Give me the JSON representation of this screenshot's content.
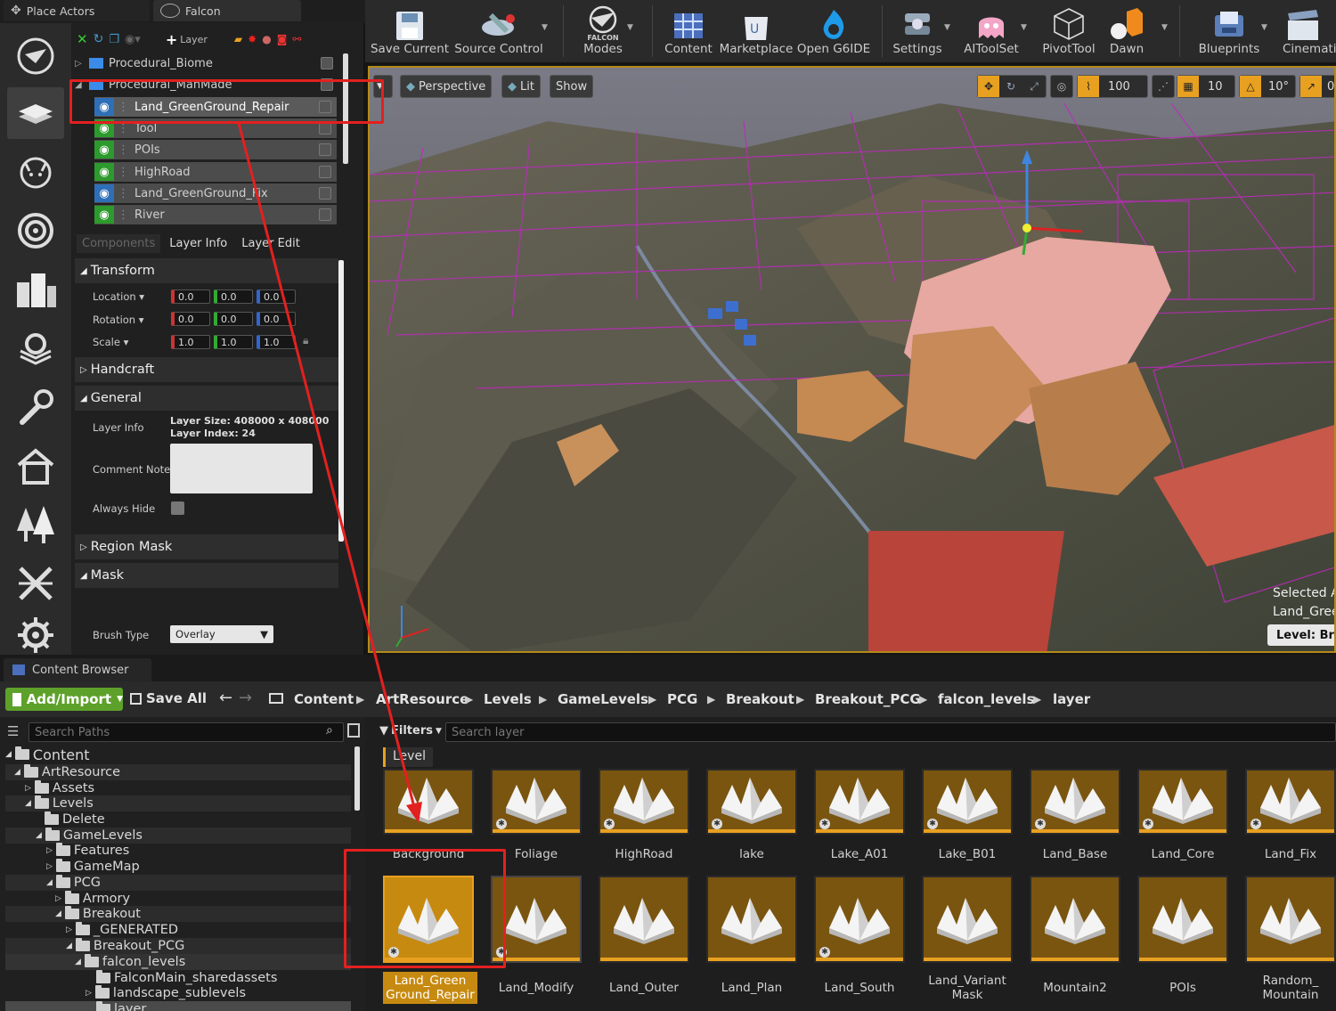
{
  "tabs": {
    "place_actors": "Place Actors",
    "falcon": "Falcon"
  },
  "layers": {
    "toolbar_add_label": "Layer",
    "items": [
      {
        "label": "Procedural_Biome",
        "kind": "folder"
      },
      {
        "label": "Procedural_ManMade",
        "kind": "folder"
      },
      {
        "label": "Land_GreenGround_Repair",
        "kind": "layer"
      },
      {
        "label": "Tool",
        "kind": "layer"
      },
      {
        "label": "POIs",
        "kind": "layer"
      },
      {
        "label": "HighRoad",
        "kind": "layer"
      },
      {
        "label": "Land_GreenGround_Fix",
        "kind": "layer"
      },
      {
        "label": "River",
        "kind": "layer"
      }
    ]
  },
  "details": {
    "tabs": [
      "Components",
      "Layer Info",
      "Layer Edit"
    ],
    "transform": "Transform",
    "location_label": "Location",
    "rotation_label": "Rotation",
    "scale_label": "Scale",
    "location": [
      "0.0",
      "0.0",
      "0.0"
    ],
    "rotation": [
      "0.0",
      "0.0",
      "0.0"
    ],
    "scale": [
      "1.0",
      "1.0",
      "1.0"
    ],
    "handcraft": "Handcraft",
    "general": "General",
    "layer_info_label": "Layer Info",
    "layer_size": "Layer Size: 408000 x 408000",
    "layer_index": "Layer Index: 24",
    "comment_notes_label": "Comment Notes",
    "always_hide_label": "Always Hide",
    "region_mask": "Region Mask",
    "mask": "Mask",
    "brush_type_label": "Brush Type",
    "brush_type_value": "Overlay"
  },
  "toolbar": {
    "save_current": "Save Current",
    "source_control": "Source Control",
    "falcon_modes_logo": "FALCON",
    "falcon_modes": "Modes",
    "content": "Content",
    "marketplace": "Marketplace",
    "open_g6ide": "Open G6IDE",
    "settings": "Settings",
    "aitoolset": "AIToolSet",
    "pivottool": "PivotTool",
    "dawn": "Dawn",
    "blueprints": "Blueprints",
    "cinematics": "Cinematic"
  },
  "viewport": {
    "perspective": "Perspective",
    "lit": "Lit",
    "show": "Show",
    "grid_snap": "100",
    "rot_snap": "10",
    "angle_snap": "10°",
    "cam_speed": "0",
    "selected_line1": "Selected A",
    "selected_line2": "Land_Gree",
    "level_label": "Level:  Brea"
  },
  "content_browser": {
    "tab": "Content Browser",
    "add_import": "Add/Import",
    "save_all": "Save All",
    "breadcrumbs": [
      "Content",
      "ArtResource",
      "Levels",
      "GameLevels",
      "PCG",
      "Breakout",
      "Breakout_PCG",
      "falcon_levels",
      "layer"
    ],
    "search_paths_placeholder": "Search Paths",
    "filters": "Filters",
    "search_layer_placeholder": "Search layer",
    "filter_chip": "Level",
    "tree": [
      {
        "label": "Content",
        "depth": 0,
        "arrow": "◢"
      },
      {
        "label": "ArtResource",
        "depth": 1,
        "arrow": "◢"
      },
      {
        "label": "Assets",
        "depth": 2,
        "arrow": "▷"
      },
      {
        "label": "Levels",
        "depth": 2,
        "arrow": "◢"
      },
      {
        "label": "Delete",
        "depth": 3,
        "arrow": ""
      },
      {
        "label": "GameLevels",
        "depth": 3,
        "arrow": "◢"
      },
      {
        "label": "Features",
        "depth": 4,
        "arrow": "▷"
      },
      {
        "label": "GameMap",
        "depth": 4,
        "arrow": "▷"
      },
      {
        "label": "PCG",
        "depth": 4,
        "arrow": "◢"
      },
      {
        "label": "Armory",
        "depth": 5,
        "arrow": "▷"
      },
      {
        "label": "Breakout",
        "depth": 5,
        "arrow": "◢"
      },
      {
        "label": "_GENERATED",
        "depth": 6,
        "arrow": "▷"
      },
      {
        "label": "Breakout_PCG",
        "depth": 6,
        "arrow": "◢"
      },
      {
        "label": "falcon_levels",
        "depth": 7,
        "arrow": "◢"
      },
      {
        "label": "FalconMain_sharedassets",
        "depth": 8,
        "arrow": ""
      },
      {
        "label": "landscape_sublevels",
        "depth": 8,
        "arrow": "▷"
      },
      {
        "label": "layer",
        "depth": 8,
        "arrow": ""
      }
    ],
    "row1": [
      "Background",
      "Foliage",
      "HighRoad",
      "lake",
      "Lake_A01",
      "Lake_B01",
      "Land_Base",
      "Land_Core",
      "Land_Fix"
    ],
    "row2": [
      "Land_Green Ground_Repair",
      "Land_Modify",
      "Land_Outer",
      "Land_Plan",
      "Land_South",
      "Land_Variant Mask",
      "Mountain2",
      "POIs",
      "Random_ Mountain"
    ]
  },
  "colors": {
    "accent": "#e8a020",
    "annotation": "#e32020",
    "add_button": "#5da12a",
    "selection": "#b48a1a"
  }
}
